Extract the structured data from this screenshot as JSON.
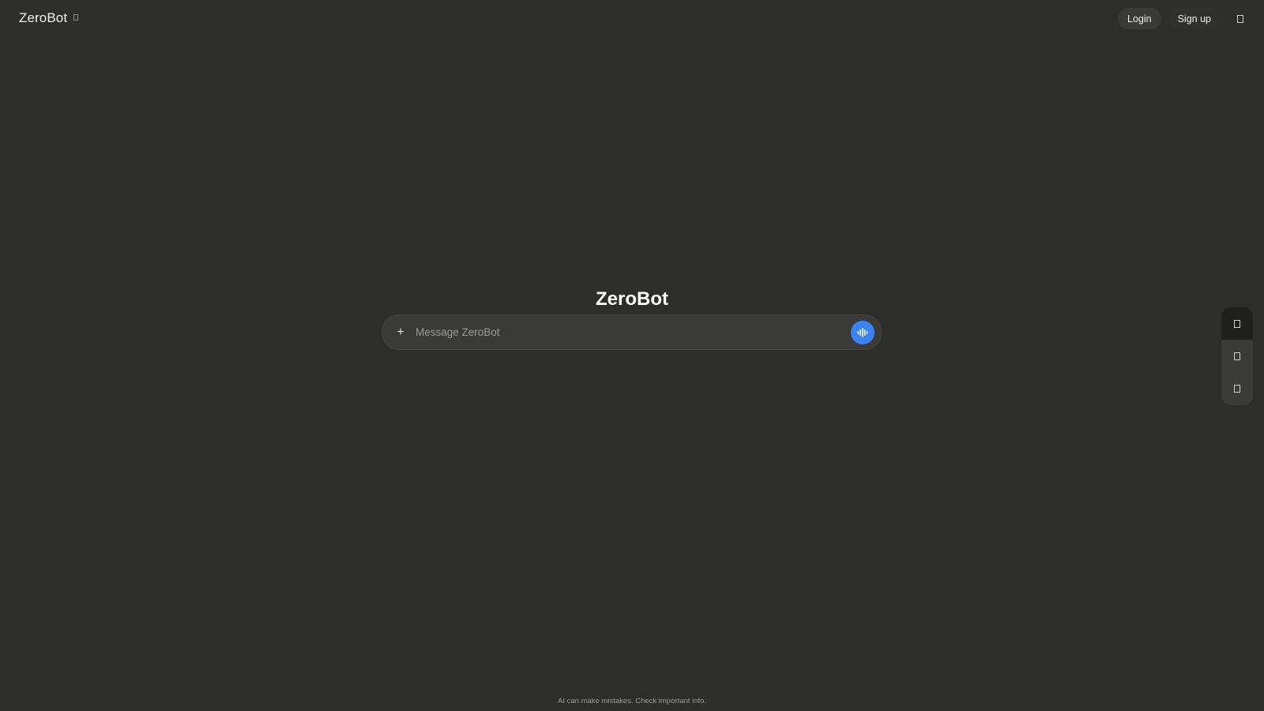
{
  "app": {
    "name": "ZeroBot"
  },
  "header": {
    "brand": "ZeroBot",
    "login_label": "Login",
    "signup_label": "Sign up",
    "brand_dropdown_icon": "missing-glyph-icon",
    "menu_icon": "missing-glyph-icon"
  },
  "main": {
    "title": "ZeroBot",
    "composer": {
      "placeholder": "Message ZeroBot",
      "value": "",
      "attach_label": "+",
      "voice_icon": "voice-waveform-icon"
    }
  },
  "side_dock": {
    "items": [
      {
        "icon": "missing-glyph-icon",
        "active": true
      },
      {
        "icon": "missing-glyph-icon",
        "active": false
      },
      {
        "icon": "missing-glyph-icon",
        "active": false
      }
    ]
  },
  "footer": {
    "disclaimer": "AI can make mistakes. Check important info."
  },
  "colors": {
    "background": "#2d2d2a",
    "accent": "#3b82f6",
    "surface": "#3a3a38"
  }
}
